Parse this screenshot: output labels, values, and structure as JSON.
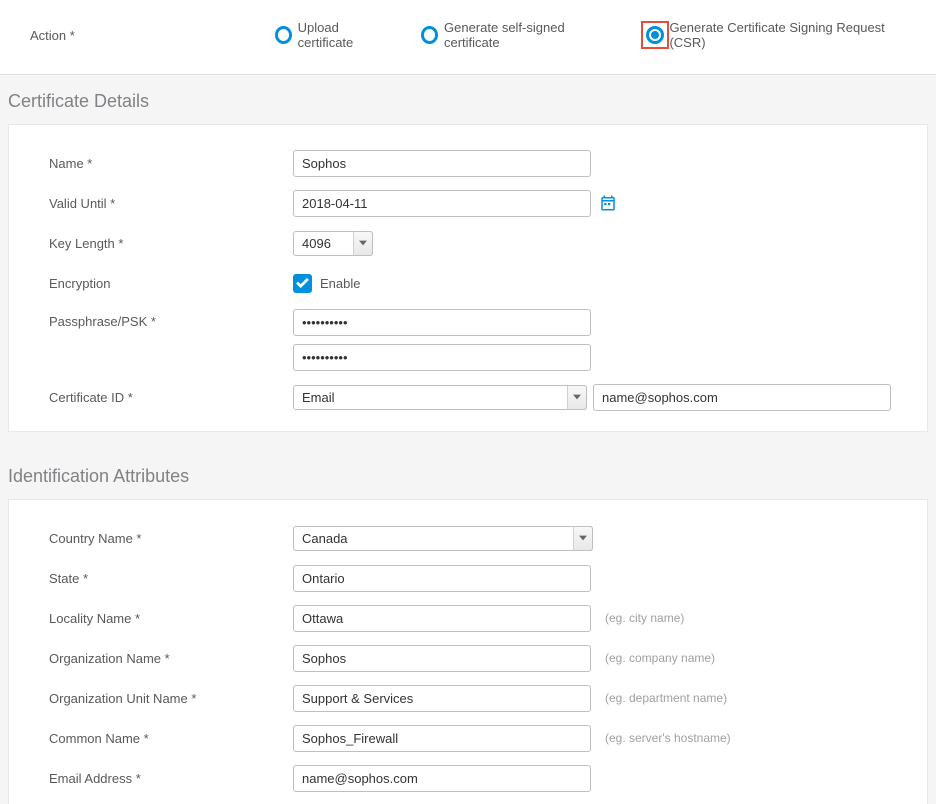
{
  "action": {
    "label": "Action *",
    "options": {
      "upload": "Upload certificate",
      "selfsigned": "Generate self-signed certificate",
      "csr": "Generate Certificate Signing Request (CSR)"
    }
  },
  "cert_details": {
    "title": "Certificate Details",
    "name": {
      "label": "Name *",
      "value": "Sophos"
    },
    "valid_until": {
      "label": "Valid Until *",
      "value": "2018-04-11"
    },
    "key_length": {
      "label": "Key Length *",
      "value": "4096"
    },
    "encryption": {
      "label": "Encryption",
      "enable_label": "Enable"
    },
    "passphrase": {
      "label": "Passphrase/PSK *",
      "value1": "••••••••••",
      "value2": "••••••••••"
    },
    "cert_id": {
      "label": "Certificate ID *",
      "type": "Email",
      "value": "name@sophos.com"
    }
  },
  "ident": {
    "title": "Identification Attributes",
    "country": {
      "label": "Country Name *",
      "value": "Canada"
    },
    "state": {
      "label": "State *",
      "value": "Ontario"
    },
    "locality": {
      "label": "Locality Name *",
      "value": "Ottawa",
      "hint": "(eg. city name)"
    },
    "org": {
      "label": "Organization Name *",
      "value": "Sophos",
      "hint": "(eg. company name)"
    },
    "org_unit": {
      "label": "Organization Unit Name *",
      "value": "Support & Services",
      "hint": "(eg. department name)"
    },
    "common": {
      "label": "Common Name *",
      "value": "Sophos_Firewall",
      "hint": "(eg. server's hostname)"
    },
    "email": {
      "label": "Email Address *",
      "value": "name@sophos.com"
    }
  }
}
